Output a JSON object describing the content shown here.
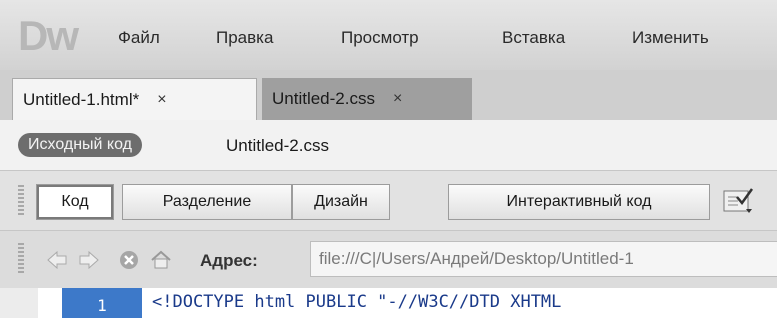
{
  "app": {
    "logo": "Dw"
  },
  "menu": [
    "Файл",
    "Правка",
    "Просмотр",
    "Вставка",
    "Изменить"
  ],
  "tabs": [
    {
      "label": "Untitled-1.html*",
      "close": "×",
      "active": true
    },
    {
      "label": "Untitled-2.css",
      "close": "×",
      "active": false
    }
  ],
  "related_files": {
    "source_label": "Исходный код",
    "file": "Untitled-2.css"
  },
  "view_modes": [
    "Код",
    "Разделение",
    "Дизайн"
  ],
  "selected_view": "Код",
  "live_code_label": "Интерактивный код",
  "address": {
    "label": "Адрес:",
    "value": "file:///C|/Users/Андрей/Desktop/Untitled-1"
  },
  "code": {
    "line_number": "1",
    "line_text": "<!DOCTYPE html PUBLIC \"-//W3C//DTD XHTML"
  },
  "colors": {
    "accent": "#3d79c9",
    "pill": "#6d6d6d"
  }
}
